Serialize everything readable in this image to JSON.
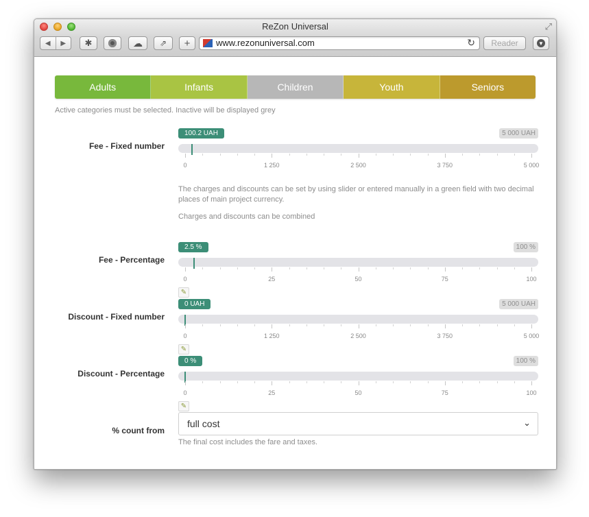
{
  "window": {
    "title": "ReZon Universal",
    "url": "www.rezonuniversal.com",
    "reader_label": "Reader"
  },
  "icons": {
    "back": "back-icon",
    "forward": "forward-icon",
    "bug": "bug-icon",
    "camera": "camera-icon",
    "cloud": "cloud-icon",
    "share": "share-icon",
    "add": "plus-icon",
    "reload": "reload-icon",
    "download": "download-icon",
    "edit": "pencil-icon",
    "chevron": "chevron-down-icon"
  },
  "colors": {
    "adults": "#78b83c",
    "infants": "#a9c443",
    "children": "#b7b7b7",
    "youth": "#c7b53a",
    "seniors": "#bc9a2d",
    "slider_accent": "#3c8e77"
  },
  "tabs": [
    {
      "label": "Adults",
      "color": "#78b83c",
      "active": true
    },
    {
      "label": "Infants",
      "color": "#a9c443",
      "active": true
    },
    {
      "label": "Children",
      "color": "#b7b7b7",
      "active": false
    },
    {
      "label": "Youth",
      "color": "#c7b53a",
      "active": true
    },
    {
      "label": "Seniors",
      "color": "#bc9a2d",
      "active": true
    }
  ],
  "categories_hint": "Active categories must be selected. Inactive will be displayed grey",
  "sliders": [
    {
      "label": "Fee - Fixed number",
      "value": 100.2,
      "value_text": "100.2 UAH",
      "max": 5000,
      "max_text": "5 000 UAH",
      "ticks": [
        "0",
        "1 250",
        "2 500",
        "3 750",
        "5 000"
      ],
      "editable": false
    },
    {
      "label": "Fee - Percentage",
      "value": 2.5,
      "value_text": "2.5 %",
      "max": 100,
      "max_text": "100 %",
      "ticks": [
        "0",
        "25",
        "50",
        "75",
        "100"
      ],
      "editable": true
    },
    {
      "label": "Discount - Fixed number",
      "value": 0,
      "value_text": "0 UAH",
      "max": 5000,
      "max_text": "5 000 UAH",
      "ticks": [
        "0",
        "1 250",
        "2 500",
        "3 750",
        "5 000"
      ],
      "editable": true
    },
    {
      "label": "Discount - Percentage",
      "value": 0,
      "value_text": "0 %",
      "max": 100,
      "max_text": "100 %",
      "ticks": [
        "0",
        "25",
        "50",
        "75",
        "100"
      ],
      "editable": true
    }
  ],
  "notes": {
    "line1": "The charges and discounts can be set by using slider or entered manually in a green field with two decimal places of main project currency.",
    "line2": "Charges and discounts can be combined"
  },
  "count_from": {
    "label": "% count from",
    "selected": "full cost",
    "help": "The final cost includes the fare and taxes."
  }
}
